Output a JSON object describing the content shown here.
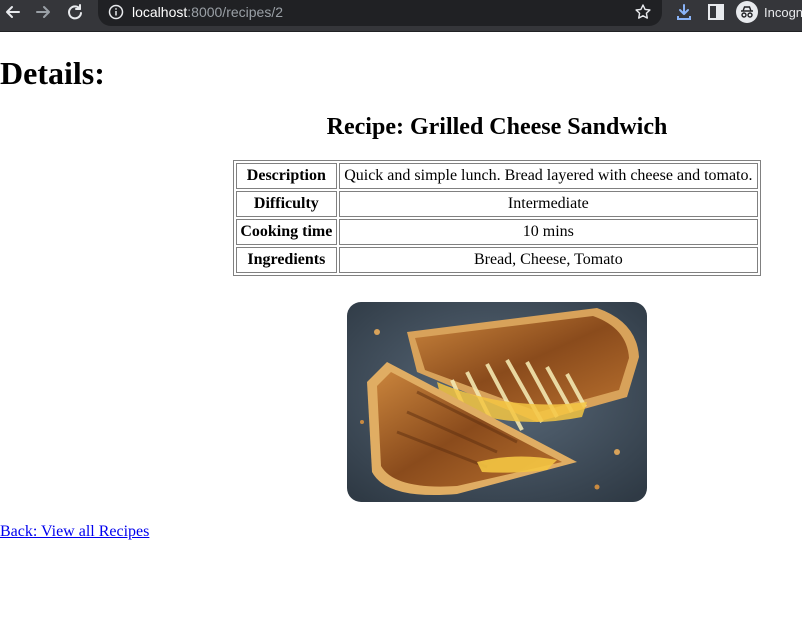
{
  "browser": {
    "url_host": "localhost",
    "url_path": ":8000/recipes/2",
    "profile_label": "Incogn"
  },
  "page": {
    "heading": "Details:",
    "recipe_title": "Recipe: Grilled Cheese Sandwich",
    "table": {
      "rows": [
        {
          "label": "Description",
          "value": "Quick and simple lunch. Bread layered with cheese and tomato."
        },
        {
          "label": "Difficulty",
          "value": "Intermediate"
        },
        {
          "label": "Cooking time",
          "value": "10 mins"
        },
        {
          "label": "Ingredients",
          "value": "Bread, Cheese, Tomato"
        }
      ]
    },
    "back_link": "Back: View all Recipes"
  },
  "icons": {
    "back": "arrow-left-icon",
    "forward": "arrow-right-icon",
    "reload": "reload-icon",
    "site_info": "info-icon",
    "bookmark": "star-icon",
    "download": "download-icon",
    "side_panel": "side-panel-icon",
    "incognito": "incognito-icon"
  },
  "colors": {
    "chrome_bg": "#35363a",
    "omnibox_bg": "#202124",
    "link": "#0000ee"
  }
}
